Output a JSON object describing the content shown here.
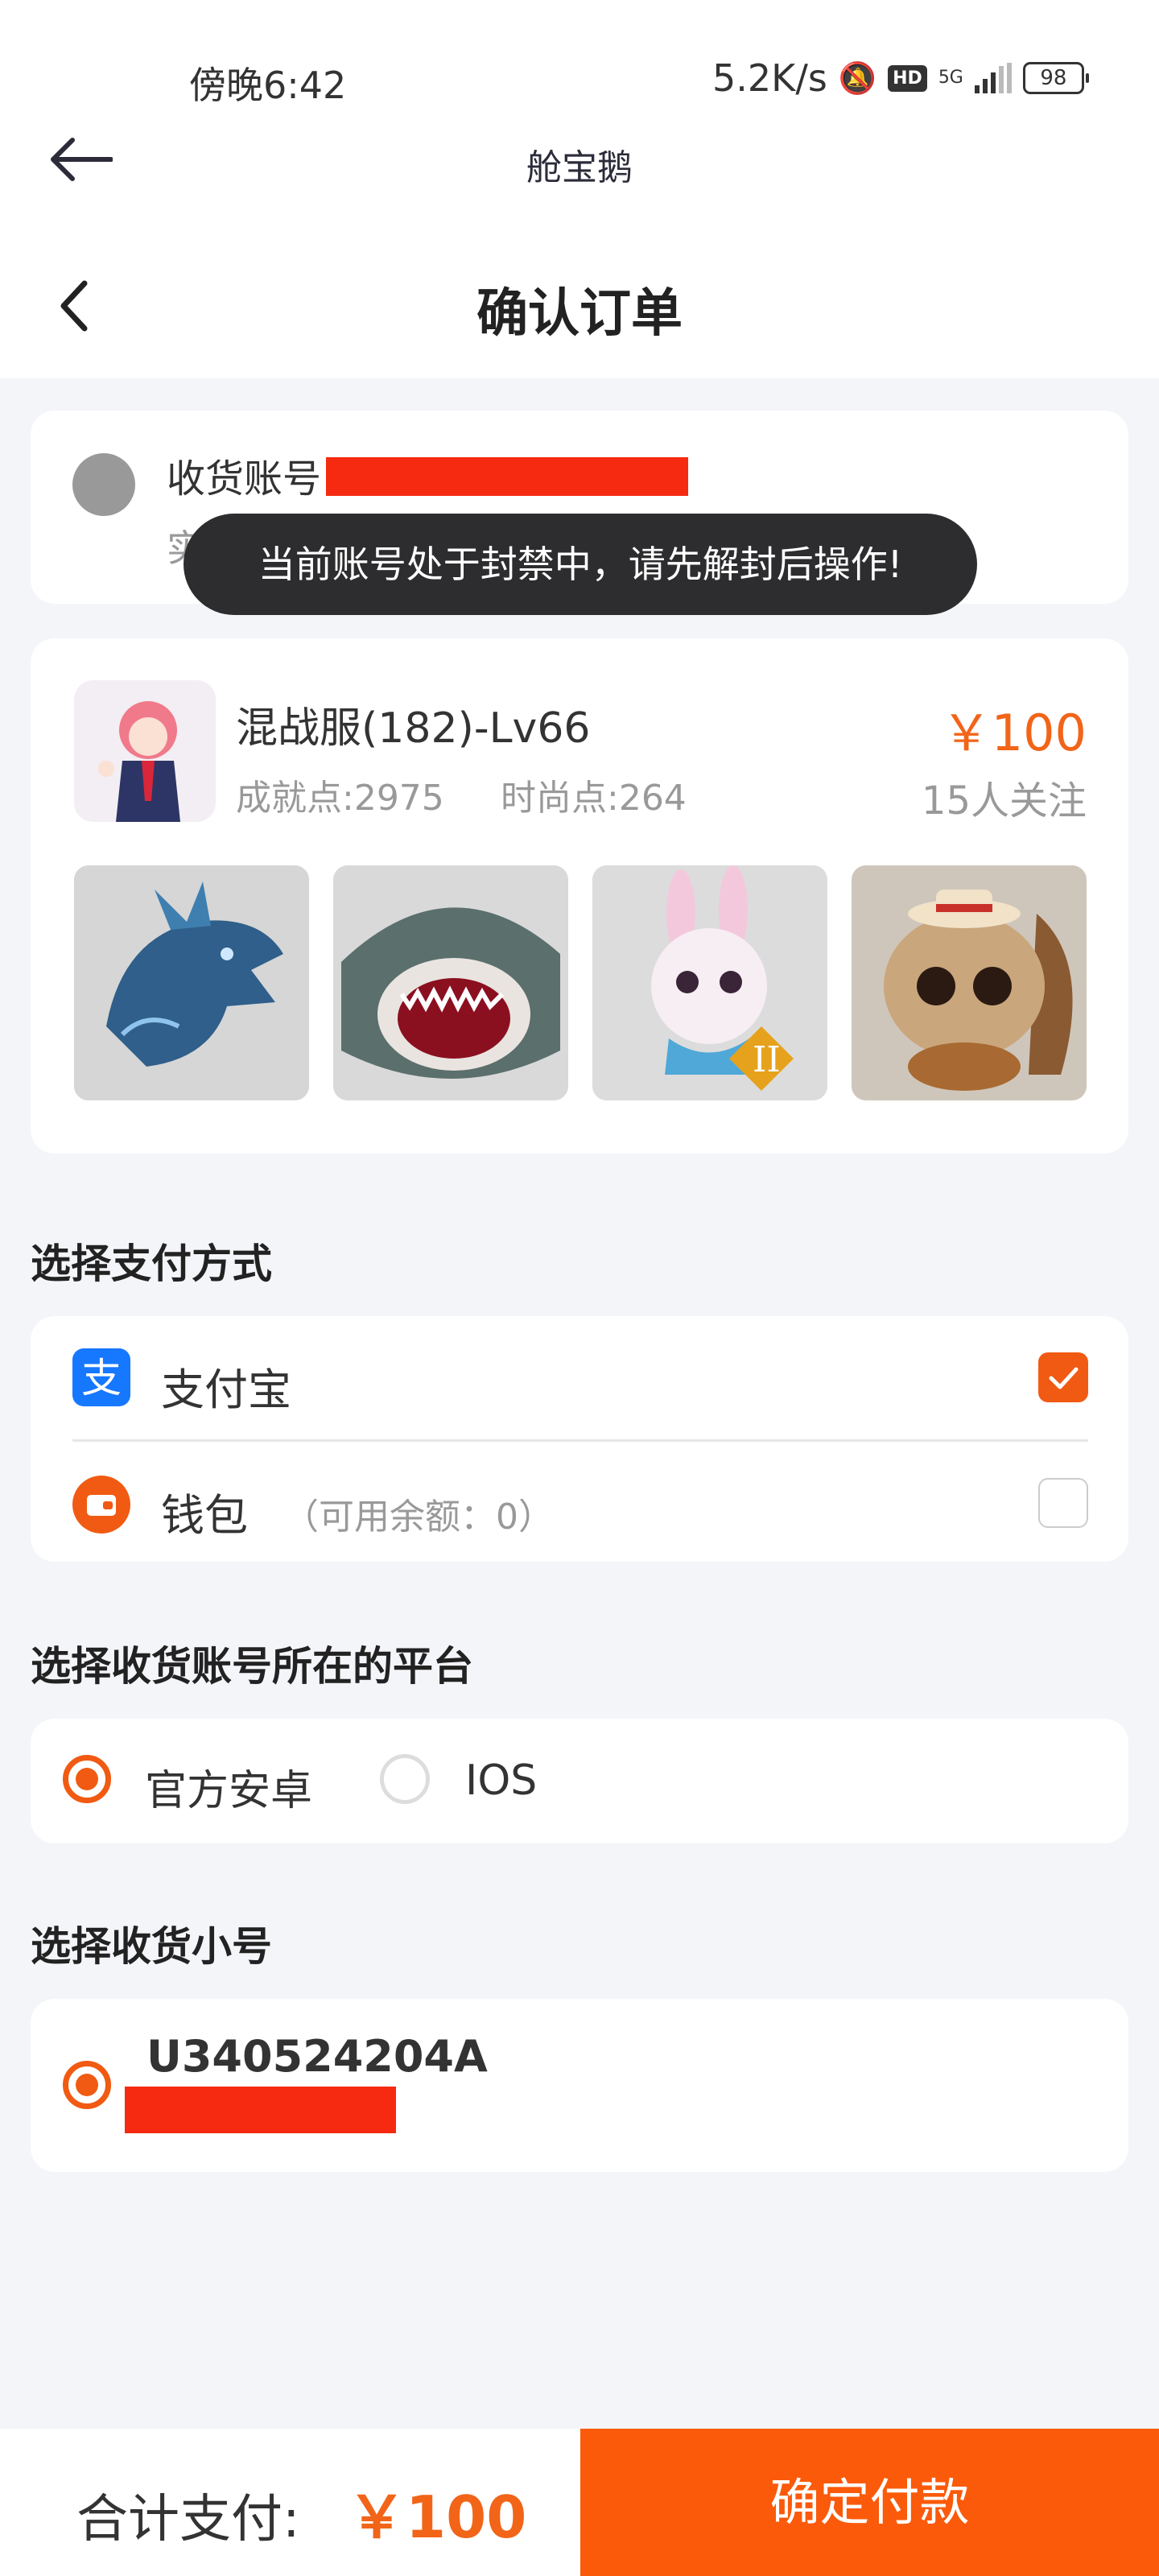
{
  "status_bar": {
    "time": "傍晚6:42",
    "network_speed": "5.2K/s",
    "hd": "HD",
    "signal_type": "5G",
    "battery": "98"
  },
  "app_header": {
    "title": "舱宝鹅"
  },
  "page_header": {
    "title": "确认订单"
  },
  "account": {
    "label": "收货账号",
    "realname": "实名：范*"
  },
  "toast": {
    "message": "当前账号处于封禁中，请先解封后操作!"
  },
  "product": {
    "name": "混战服(182)-Lv66",
    "price": "￥100",
    "achievement": "成就点:2975",
    "fashion": "时尚点:264",
    "followers": "15人关注",
    "thumbnails": [
      "blue-dragon",
      "shark",
      "pink-rabbit",
      "squirrel"
    ]
  },
  "payment": {
    "section_title": "选择支付方式",
    "options": [
      {
        "label": "支付宝",
        "selected": true,
        "icon": "alipay-icon"
      },
      {
        "label": "钱包",
        "sub": "（可用余额：0）",
        "selected": false,
        "icon": "wallet-icon"
      }
    ]
  },
  "platform": {
    "section_title": "选择收货账号所在的平台",
    "options": [
      {
        "label": "官方安卓",
        "selected": true
      },
      {
        "label": "IOS",
        "selected": false
      }
    ]
  },
  "sub_account": {
    "section_title": "选择收货小号",
    "id": "U340524204A"
  },
  "footer": {
    "total_label": "合计支付:",
    "total_amount": "￥100",
    "confirm_label": "确定付款"
  },
  "colors": {
    "accent": "#f15a12",
    "price": "#f26418",
    "redaction": "#f52a10",
    "alipay": "#1677ff"
  }
}
